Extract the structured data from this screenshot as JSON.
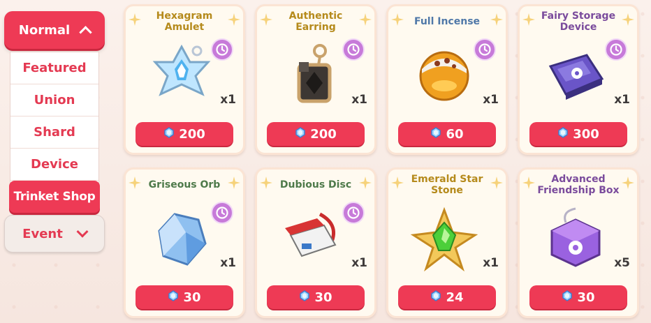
{
  "sidebar": {
    "open_tab": "Normal",
    "sub_items": [
      "Featured",
      "Union",
      "Shard",
      "Device",
      "Trinket Shop"
    ],
    "active_sub": "Trinket Shop",
    "closed_tab": "Event"
  },
  "colors": {
    "accent": "#ee3a55",
    "timer": "#c77ad9"
  },
  "items": [
    {
      "name": "Hexagram Amulet",
      "title_color": "#b58a1b",
      "qty": "x1",
      "price": "200",
      "icon": "hexagram-amulet-icon"
    },
    {
      "name": "Authentic Earring",
      "title_color": "#b58a1b",
      "qty": "x1",
      "price": "200",
      "icon": "authentic-earring-icon"
    },
    {
      "name": "Full Incense",
      "title_color": "#4f78a8",
      "qty": "x1",
      "price": "60",
      "icon": "full-incense-icon"
    },
    {
      "name": "Fairy Storage Device",
      "title_color": "#7a4b9c",
      "qty": "x1",
      "price": "300",
      "icon": "fairy-storage-device-icon"
    },
    {
      "name": "Griseous Orb",
      "title_color": "#4e7a4a",
      "qty": "x1",
      "price": "30",
      "icon": "griseous-orb-icon"
    },
    {
      "name": "Dubious Disc",
      "title_color": "#4e7a4a",
      "qty": "x1",
      "price": "30",
      "icon": "dubious-disc-icon"
    },
    {
      "name": "Emerald Star Stone",
      "title_color": "#b58a1b",
      "qty": "x1",
      "price": "24",
      "icon": "emerald-star-stone-icon"
    },
    {
      "name": "Advanced Friendship Box",
      "title_color": "#7a4b9c",
      "qty": "x5",
      "price": "30",
      "icon": "advanced-friendship-box-icon"
    }
  ]
}
